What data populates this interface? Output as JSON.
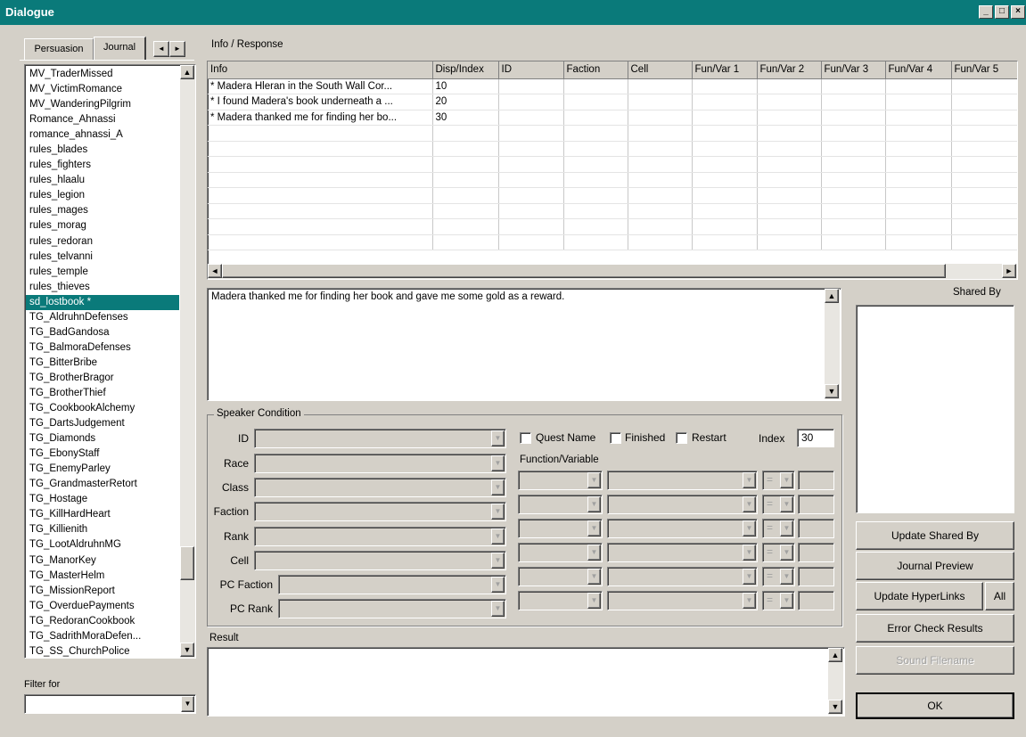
{
  "window": {
    "title": "Dialogue",
    "controls": [
      "_",
      "□",
      "×"
    ]
  },
  "tabs": [
    {
      "label": "Persuasion",
      "active": false
    },
    {
      "label": "Journal",
      "active": true
    }
  ],
  "tab_scroll": {
    "left": "◄",
    "right": "►"
  },
  "topics": [
    "MV_TraderMissed",
    "MV_VictimRomance",
    "MV_WanderingPilgrim",
    "Romance_Ahnassi",
    "romance_ahnassi_A",
    "rules_blades",
    "rules_fighters",
    "rules_hlaalu",
    "rules_legion",
    "rules_mages",
    "rules_morag",
    "rules_redoran",
    "rules_telvanni",
    "rules_temple",
    "rules_thieves",
    "sd_lostbook *",
    "TG_AldruhnDefenses",
    "TG_BadGandosa",
    "TG_BalmoraDefenses",
    "TG_BitterBribe",
    "TG_BrotherBragor",
    "TG_BrotherThief",
    "TG_CookbookAlchemy",
    "TG_DartsJudgement",
    "TG_Diamonds",
    "TG_EbonyStaff",
    "TG_EnemyParley",
    "TG_GrandmasterRetort",
    "TG_Hostage",
    "TG_KillHardHeart",
    "TG_Killienith",
    "TG_LootAldruhnMG",
    "TG_ManorKey",
    "TG_MasterHelm",
    "TG_MissionReport",
    "TG_OverduePayments",
    "TG_RedoranCookbook",
    "TG_SadrithMoraDefen...",
    "TG_SS_ChurchPolice"
  ],
  "selected_topic": "sd_lostbook *",
  "filter": {
    "label": "Filter for",
    "value": ""
  },
  "info_response": {
    "label": "Info / Response",
    "columns": [
      "Info",
      "Disp/Index",
      "ID",
      "Faction",
      "Cell",
      "Fun/Var 1",
      "Fun/Var 2",
      "Fun/Var 3",
      "Fun/Var 4",
      "Fun/Var 5"
    ],
    "rows": [
      {
        "info": "* Madera Hleran in the South Wall Cor...",
        "index": "10"
      },
      {
        "info": "* I found Madera's book underneath a ...",
        "index": "20"
      },
      {
        "info": "* Madera thanked me for finding her bo...",
        "index": "30"
      }
    ]
  },
  "response_text": "Madera thanked me for finding her book and gave me some gold as a reward.",
  "shared_by": {
    "label": "Shared By"
  },
  "speaker_condition": {
    "label": "Speaker Condition",
    "fields": [
      "ID",
      "Race",
      "Class",
      "Faction",
      "Rank",
      "Cell",
      "PC Faction",
      "PC Rank"
    ],
    "quest_name": "Quest Name",
    "finished": "Finished",
    "restart": "Restart",
    "index_label": "Index",
    "index_value": "30",
    "function_variable": "Function/Variable",
    "op_symbol": "="
  },
  "result": {
    "label": "Result",
    "value": ""
  },
  "buttons": {
    "update_shared_by": "Update Shared By",
    "journal_preview": "Journal Preview",
    "update_hyperlinks": "Update HyperLinks",
    "all": "All",
    "error_check": "Error Check Results",
    "sound_filename": "Sound Filename",
    "ok": "OK"
  },
  "colors": {
    "title_bar": "#0a7a7a",
    "selection": "#0a7a7a",
    "face": "#d4d0c8"
  }
}
